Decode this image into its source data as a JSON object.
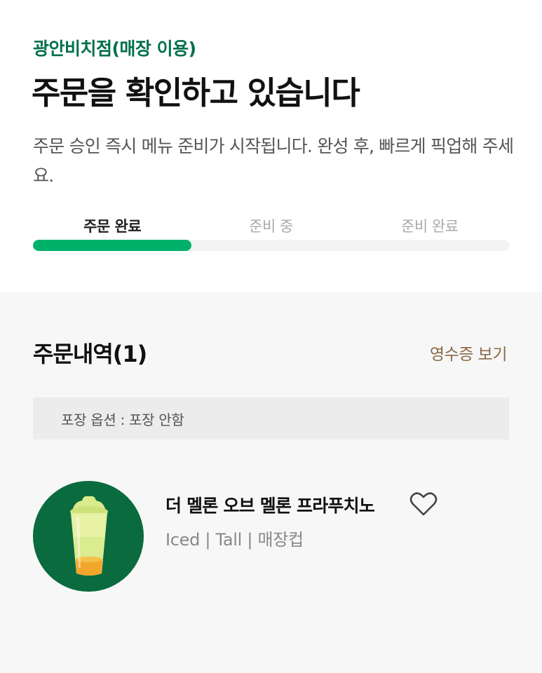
{
  "store": {
    "name": "광안비치점(매장 이용)"
  },
  "header": {
    "title": "주문을 확인하고 있습니다",
    "subtitle": "주문 승인 즉시 메뉴 준비가 시작됩니다. 완성 후, 빠르게 픽업해 주세요."
  },
  "progress": {
    "steps": [
      {
        "label": "주문 완료",
        "active": true
      },
      {
        "label": "준비 중",
        "active": false
      },
      {
        "label": "준비 완료",
        "active": false
      }
    ],
    "fraction": 0.333
  },
  "order": {
    "title": "주문내역(1)",
    "receipt_link": "영수증 보기",
    "packaging_option": "포장 옵션 : 포장 안함",
    "items": [
      {
        "name": "더 멜론 오브 멜론 프라푸치노",
        "options": "Iced | Tall | 매장컵",
        "image": "melon-frappuccino-image",
        "favorite_icon": "heart-outline-icon"
      }
    ]
  },
  "colors": {
    "brand_green": "#00704a",
    "progress_green": "#00b16a",
    "link_brown": "#8a6a46",
    "thumb_bg": "#0a6b3e"
  }
}
